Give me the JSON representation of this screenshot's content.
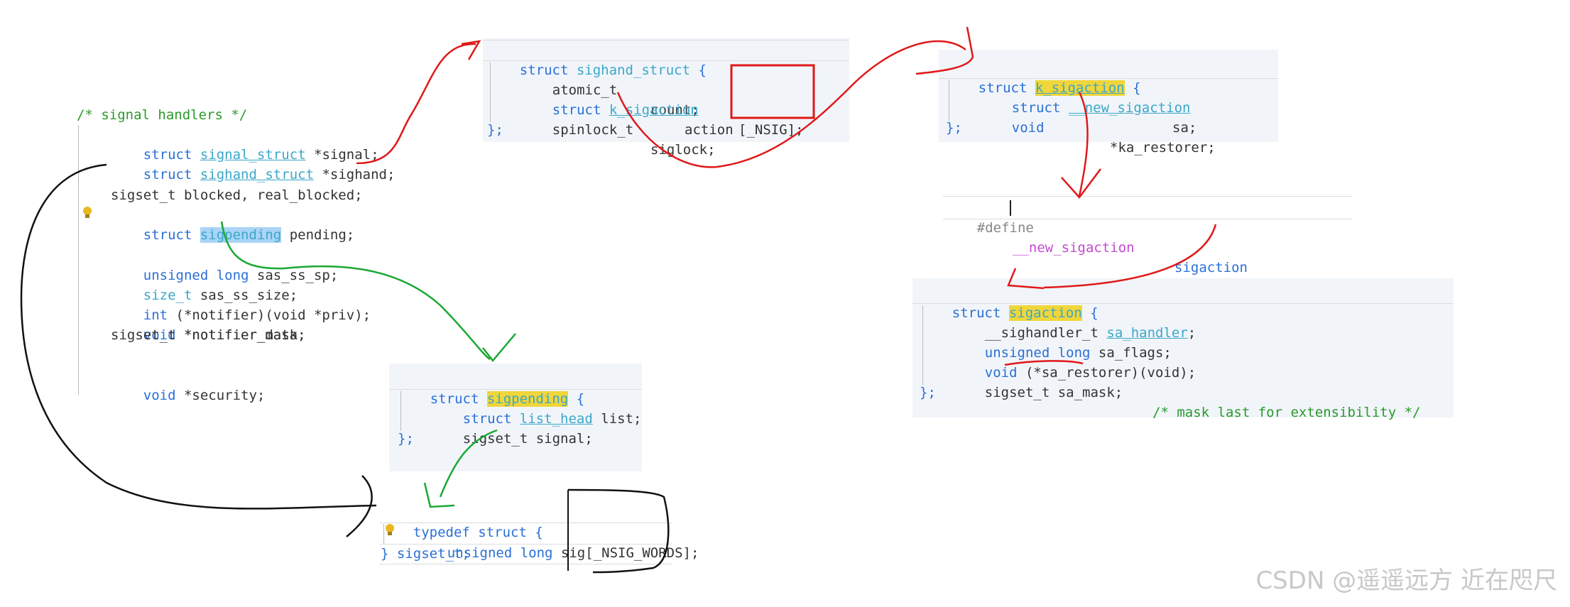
{
  "panel_task": {
    "comment": "/* signal handlers */",
    "lines": [
      {
        "kw": "struct",
        "type": "signal_struct",
        "rest": " *signal;"
      },
      {
        "kw": "struct",
        "type": "sighand_struct",
        "rest": " *sighand;"
      },
      {
        "plain": "sigset_t blocked, real_blocked;"
      },
      {
        "kw": "struct",
        "type": "sigpending",
        "rest": " pending;"
      },
      {
        "kw": "unsigned long",
        "rest": " sas_ss_sp;"
      },
      {
        "kw": "size_t",
        "rest": " sas_ss_size;"
      },
      {
        "kw": "int",
        "rest": " (*notifier)(void *priv);"
      },
      {
        "kw": "void",
        "rest": " *notifier_data;"
      },
      {
        "plain": "sigset_t *notifier_mask;"
      },
      {
        "kw": "void",
        "rest": " *security;"
      }
    ]
  },
  "panel_sighand": {
    "head_kw": "struct",
    "head_name": "sighand_struct",
    "head_brace": " {",
    "l1_type": "atomic_t",
    "l1_name": "count;",
    "l2_kw": "struct",
    "l2_type": "k_sigaction",
    "l2_name": "action",
    "l2_idx": "[_NSIG];",
    "l3_type": "spinlock_t",
    "l3_name": "siglock;",
    "close": "};"
  },
  "panel_ksig": {
    "head_kw": "struct",
    "head_name": "k_sigaction",
    "head_brace": " {",
    "l1_kw": "struct",
    "l1_type": "__new_sigaction",
    "l1_name": "sa;",
    "l2_kw": "void",
    "l2_name": "*ka_restorer;",
    "close": "};"
  },
  "define_line": {
    "directive": "#define",
    "macro": "__new_sigaction",
    "value": "sigaction"
  },
  "panel_sigaction": {
    "head_kw": "struct",
    "head_name": "sigaction",
    "head_brace": " {",
    "l1_type": "__sighandler_t",
    "l1_name": "sa_handler",
    "l1_end": ";",
    "l2_kw": "unsigned long",
    "l2_name": " sa_flags;",
    "l3_kw": "void",
    "l3_name": " (*sa_restorer)(void);",
    "l4_type": "sigset_t",
    "l4_name": " sa_mask;",
    "l4_comment": "/* mask last for extensibility */",
    "close": "};"
  },
  "panel_sigpending": {
    "head_kw": "struct",
    "head_name": "sigpending",
    "head_brace": " {",
    "l1_kw": "struct",
    "l1_type": "list_head",
    "l1_name": " list;",
    "l2_type": "sigset_t",
    "l2_name": " signal;",
    "close": "};"
  },
  "panel_sigset": {
    "head_kw": "typedef",
    "head_rest": " struct {",
    "l1_kw": "unsigned long",
    "l1_name": " sig",
    "l1_idx": "[_NSIG_WORDS];",
    "close": "} sigset_t;"
  },
  "watermark": "CSDN @遥遥远方 近在咫尺",
  "colors": {
    "red_arrow": "#e01818",
    "green_arrow": "#1aa832",
    "black_arrow": "#111111",
    "highlight_yellow": "#f0d63a",
    "highlight_blue": "#a9d4f7",
    "keyword_blue": "#2a6fd6",
    "comment_green": "#2a9a2a",
    "panel_bg": "#f1f5fa"
  }
}
